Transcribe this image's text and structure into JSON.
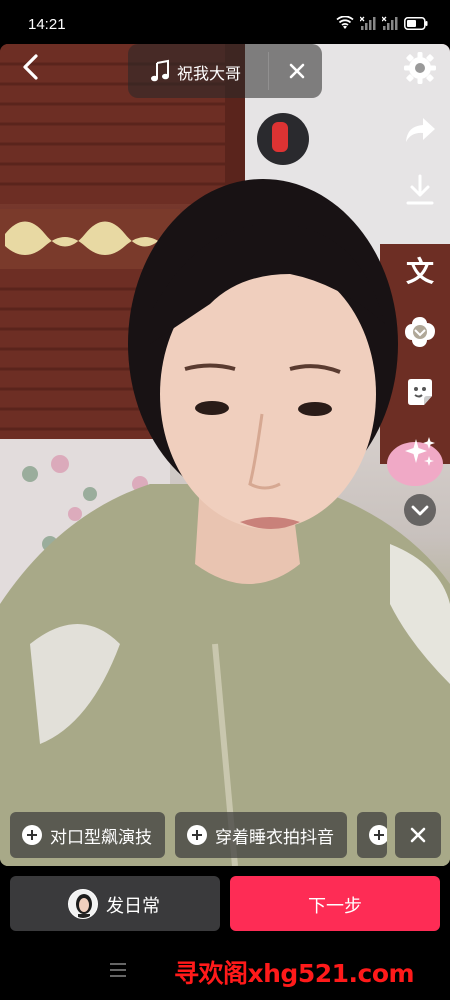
{
  "status_bar": {
    "time": "14:21",
    "icons": [
      "wifi-icon",
      "signal-icon",
      "signal-icon",
      "battery-icon"
    ]
  },
  "top_bar": {
    "back_icon": "chevron-left-icon",
    "music": {
      "icon": "music-note-icon",
      "title": "祝我大哥",
      "close_icon": "close-icon"
    }
  },
  "right_toolbar": {
    "items": [
      {
        "name": "settings",
        "icon": "gear-icon"
      },
      {
        "name": "share",
        "icon": "share-arrow-icon"
      },
      {
        "name": "download",
        "icon": "download-icon"
      },
      {
        "name": "text",
        "icon": "text-icon",
        "label": "文"
      },
      {
        "name": "sticker",
        "icon": "sticker-icon"
      },
      {
        "name": "emoji",
        "icon": "emoji-icon"
      },
      {
        "name": "effects",
        "icon": "sparkles-icon"
      },
      {
        "name": "expand",
        "icon": "chevron-down-icon"
      }
    ]
  },
  "effect_chips": {
    "items": [
      {
        "label": "对口型飙演技"
      },
      {
        "label": "穿着睡衣拍抖音"
      }
    ],
    "close_icon": "close-icon"
  },
  "bottom_actions": {
    "daily_label": "发日常",
    "next_label": "下一步"
  },
  "watermark": "寻欢阁xhg521.com",
  "colors": {
    "primary": "#fe2c55",
    "secondary_button": "#3a3a3c",
    "watermark": "#ff1a1a"
  }
}
